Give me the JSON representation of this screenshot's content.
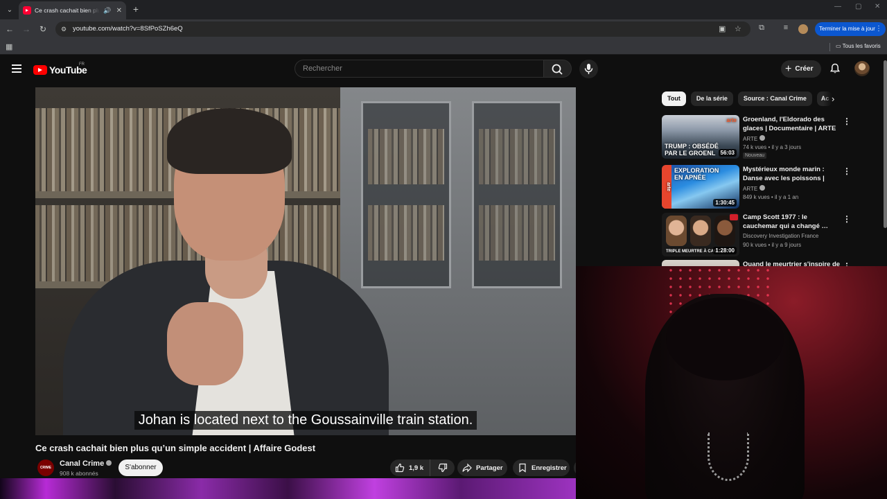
{
  "browser": {
    "tab": {
      "title": "Ce crash cachait bien plus q",
      "close": "✕"
    },
    "new_tab": "+",
    "url": "youtube.com/watch?v=8SfPoSZh6eQ",
    "update_button": "Terminer la mise à jour",
    "bookmarks_folder": "Tous les favoris",
    "window_controls": {
      "minimize": "—",
      "maximize": "▢",
      "close": "✕"
    }
  },
  "youtube": {
    "logo_text": "YouTube",
    "country": "FR",
    "search_placeholder": "Rechercher",
    "create_label": "Créer",
    "video": {
      "subtitle": "Johan is located next to the Goussainville train station.",
      "title": "Ce crash cachait bien plus qu’un simple accident | Affaire Godest",
      "channel": "Canal Crime",
      "channel_avatar_text": "CRIME",
      "subscribers": "908 k abonnés",
      "subscribe_label": "S'abonner",
      "likes": "1,9 k",
      "share_label": "Partager",
      "save_label": "Enregistrer"
    },
    "chips": [
      "Tout",
      "De la série",
      "Source : Canal Crime",
      "Ac"
    ],
    "recommendations": [
      {
        "title": "Groenland, l'Eldorado des glaces | Documentaire | ARTE",
        "channel": "ARTE",
        "meta": "74 k vues • il y a 3 jours",
        "badge": "Nouveau",
        "duration": "56:03",
        "thumb_text": "TRUMP : OBSÉDÉ PAR LE GROENL",
        "thumb_logo": "arte"
      },
      {
        "title": "Mystérieux monde marin : Danse avec les poissons | ARTE",
        "channel": "ARTE",
        "meta": "849 k vues • il y a 1 an",
        "duration": "1:30:45",
        "thumb_text": "EXPLORATION EN APNÉE",
        "thumb_logo": "arte"
      },
      {
        "title": "Camp Scott 1977 : le cauchemar qui a changé …",
        "channel": "Discovery Investigation France",
        "meta": "90 k vues • il y a 9 jours",
        "duration": "1:28:00",
        "thumb_text": "TRIPLE MEURTRE À CAM"
      },
      {
        "title": "Quand le meurtrier s'inspire de"
      }
    ]
  },
  "colors": {
    "brand_red": "#ff0000",
    "update_blue": "#0b57d0",
    "bg": "#0f0f0f"
  }
}
